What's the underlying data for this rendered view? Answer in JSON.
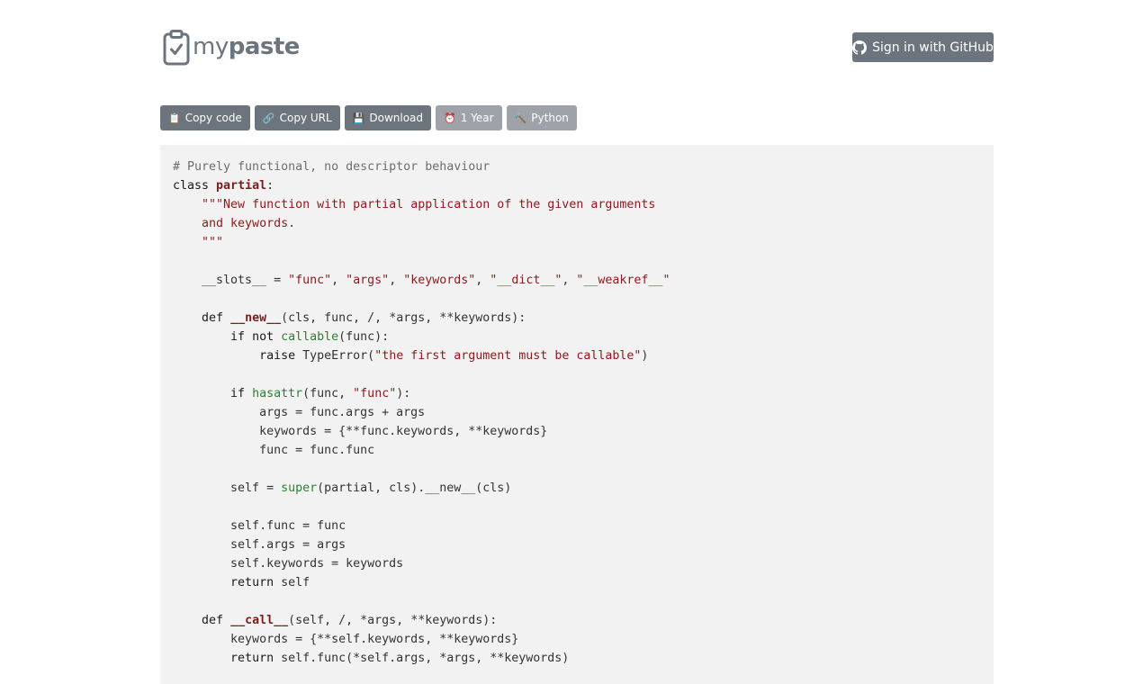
{
  "header": {
    "logo_prefix": "my",
    "logo_suffix": "paste",
    "signin_label": "Sign in with GitHub"
  },
  "toolbar": {
    "copy_code": {
      "icon": "📋",
      "label": "Copy code"
    },
    "copy_url": {
      "icon": "🔗",
      "label": "Copy URL"
    },
    "download": {
      "icon": "💾",
      "label": "Download"
    },
    "expiry": {
      "icon": "⏰",
      "label": "1 Year"
    },
    "language": {
      "icon": "🔨",
      "label": "Python"
    }
  },
  "icons": {
    "logo": "clipboard-check-icon",
    "github": "github-icon"
  },
  "colors": {
    "button_dark": "#6c757d",
    "button_light": "#9da3a8",
    "code_background": "#f2f2f2",
    "string": "#8b1a1a",
    "builtin": "#2e7d32",
    "comment": "#6e6e6e"
  },
  "code": {
    "lines": [
      [
        [
          "c",
          "# Purely functional, no descriptor behaviour"
        ]
      ],
      [
        [
          "k",
          "class "
        ],
        [
          "nc",
          "partial"
        ],
        [
          "o",
          ":"
        ]
      ],
      [
        [
          "o",
          "    "
        ],
        [
          "s",
          "\"\"\"New function with partial application of the given arguments"
        ]
      ],
      [
        [
          "s",
          "    and keywords."
        ]
      ],
      [
        [
          "s",
          "    \"\"\""
        ]
      ],
      [],
      [
        [
          "o",
          "    __slots__ = "
        ],
        [
          "s",
          "\"func\""
        ],
        [
          "o",
          ", "
        ],
        [
          "s",
          "\"args\""
        ],
        [
          "o",
          ", "
        ],
        [
          "s",
          "\"keywords\""
        ],
        [
          "o",
          ", "
        ],
        [
          "s",
          "\"__dict__\""
        ],
        [
          "o",
          ", "
        ],
        [
          "s",
          "\"__weakref__\""
        ]
      ],
      [],
      [
        [
          "o",
          "    "
        ],
        [
          "k",
          "def "
        ],
        [
          "nf",
          "__new__"
        ],
        [
          "o",
          "(cls, func, /, *args, **keywords):"
        ]
      ],
      [
        [
          "o",
          "        "
        ],
        [
          "k",
          "if not "
        ],
        [
          "bi",
          "callable"
        ],
        [
          "o",
          "(func):"
        ]
      ],
      [
        [
          "o",
          "            "
        ],
        [
          "k",
          "raise "
        ],
        [
          "o",
          "TypeError("
        ],
        [
          "s",
          "\"the first argument must be callable\""
        ],
        [
          "o",
          ")"
        ]
      ],
      [],
      [
        [
          "o",
          "        "
        ],
        [
          "k",
          "if "
        ],
        [
          "bi",
          "hasattr"
        ],
        [
          "o",
          "(func, "
        ],
        [
          "s",
          "\"func\""
        ],
        [
          "o",
          "):"
        ]
      ],
      [
        [
          "o",
          "            args = func.args + args"
        ]
      ],
      [
        [
          "o",
          "            keywords = {**func.keywords, **keywords}"
        ]
      ],
      [
        [
          "o",
          "            func = func.func"
        ]
      ],
      [],
      [
        [
          "o",
          "        self = "
        ],
        [
          "bi",
          "super"
        ],
        [
          "o",
          "(partial, cls).__new__(cls)"
        ]
      ],
      [],
      [
        [
          "o",
          "        self.func = func"
        ]
      ],
      [
        [
          "o",
          "        self.args = args"
        ]
      ],
      [
        [
          "o",
          "        self.keywords = keywords"
        ]
      ],
      [
        [
          "o",
          "        "
        ],
        [
          "k",
          "return "
        ],
        [
          "o",
          "self"
        ]
      ],
      [],
      [
        [
          "o",
          "    "
        ],
        [
          "k",
          "def "
        ],
        [
          "nf",
          "__call__"
        ],
        [
          "o",
          "(self, /, *args, **keywords):"
        ]
      ],
      [
        [
          "o",
          "        keywords = {**self.keywords, **keywords}"
        ]
      ],
      [
        [
          "o",
          "        "
        ],
        [
          "k",
          "return "
        ],
        [
          "o",
          "self.func(*self.args, *args, **keywords)"
        ]
      ]
    ]
  }
}
